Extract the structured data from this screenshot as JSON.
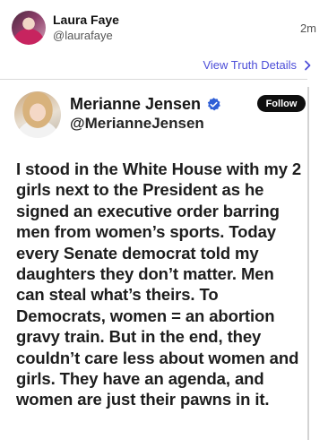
{
  "outer_post": {
    "author_name": "Laura Faye",
    "handle": "@laurafaye",
    "timestamp": "2m",
    "view_details_label": "View Truth Details"
  },
  "quoted_post": {
    "author_name": "Merianne Jensen",
    "handle": "@MerianneJensen",
    "verified": true,
    "follow_label": "Follow",
    "lines": [
      "I stood in the White House with my 2",
      "girls next to the President as he",
      "signed an executive order barring",
      "men from women’s sports. Today",
      "every Senate democrat told my",
      "daughters they don’t matter. Men",
      "can steal what’s theirs. To",
      "Democrats, women = an abortion",
      "gravy train. But in the end, they",
      "couldn’t care less about women and",
      "girls. They have an agenda, and",
      "women are just their pawns in it."
    ]
  },
  "colors": {
    "link": "#4d4ed8",
    "verified_badge": "#2f5fd6",
    "follow_bg": "#0f0f0f"
  },
  "icons": [
    "chevron-right-icon",
    "verified-badge-icon"
  ]
}
